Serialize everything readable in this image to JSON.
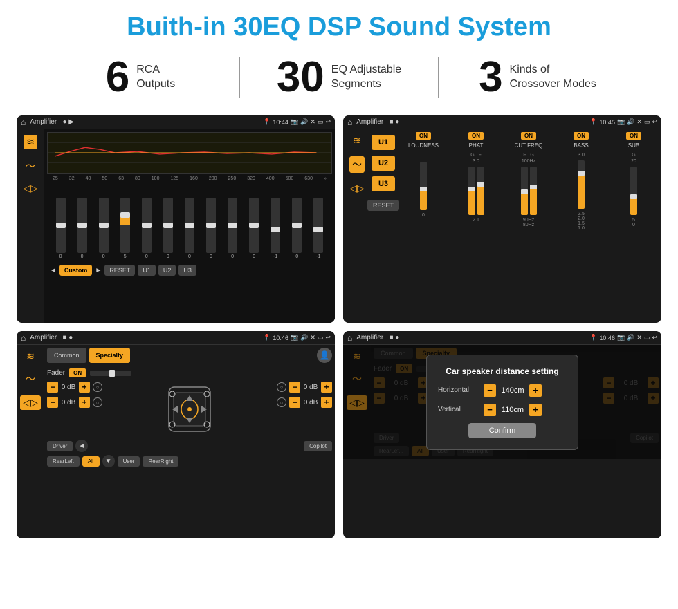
{
  "page": {
    "title": "Buith-in 30EQ DSP Sound System"
  },
  "stats": [
    {
      "number": "6",
      "label": "RCA\nOutputs"
    },
    {
      "number": "30",
      "label": "EQ Adjustable\nSegments"
    },
    {
      "number": "3",
      "label": "Kinds of\nCrossover Modes"
    }
  ],
  "screens": {
    "eq": {
      "title": "Amplifier",
      "time": "10:44",
      "frequencies": [
        "25",
        "32",
        "40",
        "50",
        "63",
        "80",
        "100",
        "125",
        "160",
        "200",
        "250",
        "320",
        "400",
        "500",
        "630"
      ],
      "values": [
        "0",
        "0",
        "0",
        "5",
        "0",
        "0",
        "0",
        "0",
        "0",
        "0",
        "-1",
        "0",
        "-1"
      ],
      "preset": "Custom",
      "buttons": [
        "RESET",
        "U1",
        "U2",
        "U3"
      ]
    },
    "crossover": {
      "title": "Amplifier",
      "time": "10:45",
      "uButtons": [
        "U1",
        "U2",
        "U3"
      ],
      "columns": [
        {
          "label": "LOUDNESS",
          "on": true
        },
        {
          "label": "PHAT",
          "on": true
        },
        {
          "label": "CUT FREQ",
          "on": true
        },
        {
          "label": "BASS",
          "on": true
        },
        {
          "label": "SUB",
          "on": true
        }
      ],
      "resetLabel": "RESET"
    },
    "fader": {
      "title": "Amplifier",
      "time": "10:46",
      "tabs": [
        "Common",
        "Specialty"
      ],
      "activeTab": "Specialty",
      "faderLabel": "Fader",
      "onToggle": "ON",
      "leftDbValues": [
        "0 dB",
        "0 dB"
      ],
      "rightDbValues": [
        "0 dB",
        "0 dB"
      ],
      "bottomButtons": [
        "Driver",
        "RearLeft",
        "All",
        "User",
        "Copilot",
        "RearRight"
      ],
      "allActive": true
    },
    "dialog": {
      "title": "Amplifier",
      "time": "10:46",
      "tabs": [
        "Common",
        "Specialty"
      ],
      "dialogTitle": "Car speaker distance setting",
      "horizontal": {
        "label": "Horizontal",
        "value": "140cm"
      },
      "vertical": {
        "label": "Vertical",
        "value": "110cm"
      },
      "confirmLabel": "Confirm",
      "leftDbValues": [
        "0 dB",
        "0 dB"
      ],
      "rightDbValues": [
        "0 dB",
        "0 dB"
      ],
      "bottomButtons": [
        "Driver",
        "RearLef...",
        "All",
        "User",
        "Copilot",
        "RearRight"
      ]
    }
  }
}
